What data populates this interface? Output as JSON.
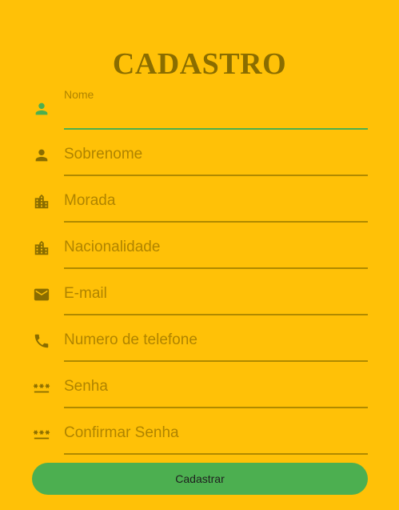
{
  "header": {
    "title": "CADASTRO"
  },
  "fields": [
    {
      "id": "nome",
      "label": "Nome",
      "placeholder": "",
      "icon": "person-icon",
      "focused": true
    },
    {
      "id": "sobrenome",
      "label": "",
      "placeholder": "Sobrenome",
      "icon": "person-icon"
    },
    {
      "id": "morada",
      "label": "",
      "placeholder": "Morada",
      "icon": "building-icon"
    },
    {
      "id": "nacionalidade",
      "label": "",
      "placeholder": "Nacionalidade",
      "icon": "building-icon"
    },
    {
      "id": "email",
      "label": "",
      "placeholder": "E-mail",
      "icon": "mail-icon"
    },
    {
      "id": "telefone",
      "label": "",
      "placeholder": "Numero de telefone",
      "icon": "phone-icon"
    },
    {
      "id": "senha",
      "label": "",
      "placeholder": "Senha",
      "icon": "password-icon"
    },
    {
      "id": "confirmar",
      "label": "",
      "placeholder": "Confirmar Senha",
      "icon": "password-icon"
    }
  ],
  "submit": {
    "label": "Cadastrar"
  },
  "colors": {
    "background": "#FFC107",
    "accent": "#4CAF50",
    "text_muted": "#B08400",
    "title": "#8A6D00"
  }
}
